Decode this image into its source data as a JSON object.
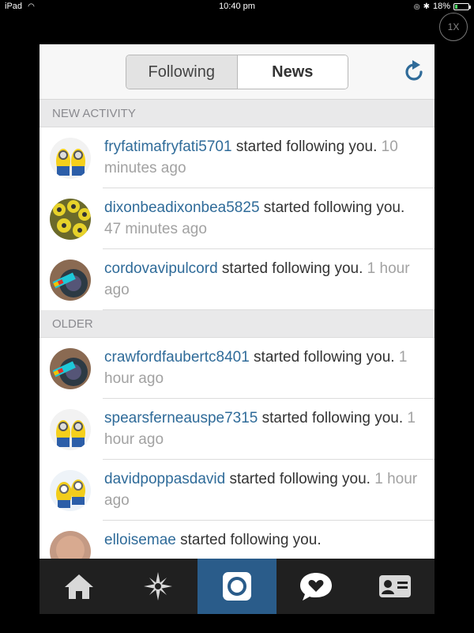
{
  "status_bar": {
    "device": "iPad",
    "time": "10:40 pm",
    "battery": "18%",
    "battery_level": 0.18
  },
  "zoom_button": {
    "label": "1X"
  },
  "header": {
    "tabs": [
      {
        "label": "Following",
        "active": false
      },
      {
        "label": "News",
        "active": true
      }
    ],
    "refresh_icon": "refresh-icon"
  },
  "sections": [
    {
      "title": "NEW ACTIVITY",
      "items": [
        {
          "user": "fryfatimafryfati5701",
          "action": " started following you.",
          "time": " 10 minutes ago",
          "avatar": "minions-pair"
        },
        {
          "user": "dixonbeadixonbea5825",
          "action": " started following you.",
          "time": " 47 minutes ago",
          "avatar": "minions-crowd"
        },
        {
          "user": "cordovavipulcord",
          "action": " started following you.",
          "time": " 1 hour ago",
          "avatar": "selfie-logo"
        }
      ]
    },
    {
      "title": "OLDER",
      "items": [
        {
          "user": "crawfordfaubertc8401",
          "action": " started following you.",
          "time": " 1 hour ago",
          "avatar": "selfie-logo"
        },
        {
          "user": "spearsferneauspe7315",
          "action": " started following you.",
          "time": " 1 hour ago",
          "avatar": "minions-pair"
        },
        {
          "user": "davidpoppasdavid",
          "action": " started following you.",
          "time": " 1 hour ago",
          "avatar": "minions-yellow"
        },
        {
          "user": "elloisemae",
          "action": " started following you.",
          "time": "",
          "avatar": "person-photo"
        }
      ]
    }
  ],
  "tabbar": {
    "items": [
      {
        "icon": "home-icon",
        "active": false
      },
      {
        "icon": "explore-icon",
        "active": false
      },
      {
        "icon": "camera-icon",
        "active": true
      },
      {
        "icon": "activity-heart-icon",
        "active": false
      },
      {
        "icon": "profile-card-icon",
        "active": false
      }
    ]
  },
  "colors": {
    "username": "#2f6b99",
    "timestamp": "#a2a2a2",
    "camera_tab": "#2a5c8a",
    "tabbar_bg": "#202020",
    "section_header_bg": "#e9e9ea",
    "refresh": "#2f6b99"
  }
}
